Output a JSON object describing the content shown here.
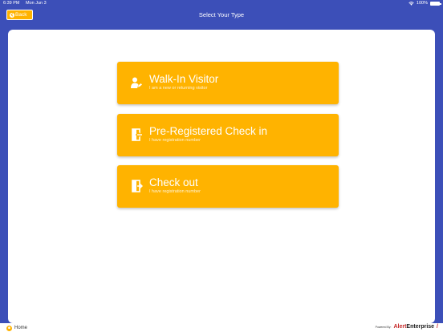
{
  "status_bar": {
    "time": "6:39 PM",
    "date": "Mon Jun 3",
    "battery": "100%"
  },
  "nav": {
    "back_label": "Back",
    "title": "Select Your Type"
  },
  "options": [
    {
      "title": "Walk-In Visitor",
      "subtitle": "I am a new or returning visitor",
      "icon": "visitor-icon"
    },
    {
      "title": "Pre-Registered Check in",
      "subtitle": "I have registration number",
      "icon": "check-in-icon"
    },
    {
      "title": "Check out",
      "subtitle": "I have registration number",
      "icon": "check-out-icon"
    }
  ],
  "footer": {
    "home_label": "Home",
    "powered_by": "Powered By:",
    "brand_alert": "Alert",
    "brand_enterprise": "Enterprise"
  },
  "colors": {
    "header": "#3c4fb8",
    "accent": "#ffb300",
    "brand_red": "#c62828"
  }
}
